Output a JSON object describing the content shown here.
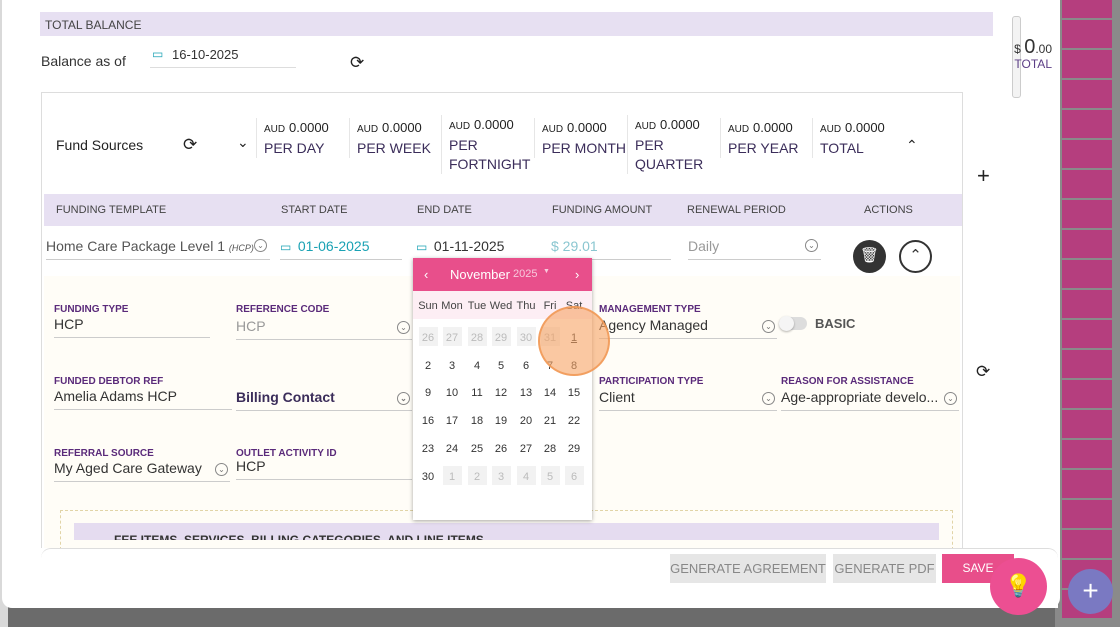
{
  "total_balance": {
    "header": "TOTAL BALANCE",
    "balance_as_of_label": "Balance as of",
    "date": "16-10-2025",
    "currency_symbol": "$",
    "amount_int": "0",
    "amount_dec": ".00",
    "total_label": "TOTAL"
  },
  "fund_sources": {
    "label": "Fund Sources",
    "stats": [
      {
        "currency": "AUD",
        "amount": "0.0000",
        "label": "PER DAY"
      },
      {
        "currency": "AUD",
        "amount": "0.0000",
        "label": "PER WEEK"
      },
      {
        "currency": "AUD",
        "amount": "0.0000",
        "label": "PER\nFORTNIGHT"
      },
      {
        "currency": "AUD",
        "amount": "0.0000",
        "label": "PER MONTH"
      },
      {
        "currency": "AUD",
        "amount": "0.0000",
        "label": "PER\nQUARTER"
      },
      {
        "currency": "AUD",
        "amount": "0.0000",
        "label": "PER YEAR"
      },
      {
        "currency": "AUD",
        "amount": "0.0000",
        "label": "TOTAL"
      }
    ]
  },
  "table": {
    "headers": [
      "FUNDING TEMPLATE",
      "START DATE",
      "END DATE",
      "FUNDING AMOUNT",
      "RENEWAL PERIOD",
      "ACTIONS"
    ],
    "row": {
      "template": "Home Care Package Level 1",
      "template_tag": "(HCP)",
      "start_date": "01-06-2025",
      "end_date": "01-11-2025",
      "amount": "$ 29.01",
      "renewal": "Daily"
    }
  },
  "details": {
    "funding_type_label": "FUNDING TYPE",
    "funding_type": "HCP",
    "reference_code_label": "REFERENCE CODE",
    "reference_code": "HCP",
    "management_type_label": "MANAGEMENT TYPE",
    "management_type": "Agency Managed",
    "basic_label": "BASIC",
    "funded_debtor_label": "FUNDED DEBTOR REF",
    "funded_debtor": "Amelia Adams HCP",
    "billing_contact": "Billing Contact",
    "participation_label": "PARTICIPATION TYPE",
    "participation": "Client",
    "reason_label": "REASON FOR ASSISTANCE",
    "reason": "Age-appropriate develo...",
    "referral_label": "REFERRAL SOURCE",
    "referral": "My Aged Care Gateway",
    "outlet_label": "OUTLET ACTIVITY ID",
    "outlet": "HCP",
    "sub_section": "FEE ITEMS, SERVICES, BILLING CATEGORIES, AND LINE ITEMS"
  },
  "datepicker": {
    "month": "November",
    "year": "2025",
    "prev": "‹",
    "next": "›",
    "dow": [
      "Sun",
      "Mon",
      "Tue",
      "Wed",
      "Thu",
      "Fri",
      "Sat"
    ],
    "weeks": [
      [
        "26",
        "27",
        "28",
        "29",
        "30",
        "31",
        "1"
      ],
      [
        "2",
        "3",
        "4",
        "5",
        "6",
        "7",
        "8"
      ],
      [
        "9",
        "10",
        "11",
        "12",
        "13",
        "14",
        "15"
      ],
      [
        "16",
        "17",
        "18",
        "19",
        "20",
        "21",
        "22"
      ],
      [
        "23",
        "24",
        "25",
        "26",
        "27",
        "28",
        "29"
      ],
      [
        "30",
        "1",
        "2",
        "3",
        "4",
        "5",
        "6"
      ]
    ],
    "selected_day": "1"
  },
  "footer": {
    "generate_agreement": "GENERATE AGREEMENT",
    "generate_pdf": "GENERATE PDF",
    "save": "SAVE"
  },
  "colors": {
    "accent_pink": "#e84f8b",
    "header_lavender": "#e7e0f2",
    "teal": "#1aa2b4"
  }
}
